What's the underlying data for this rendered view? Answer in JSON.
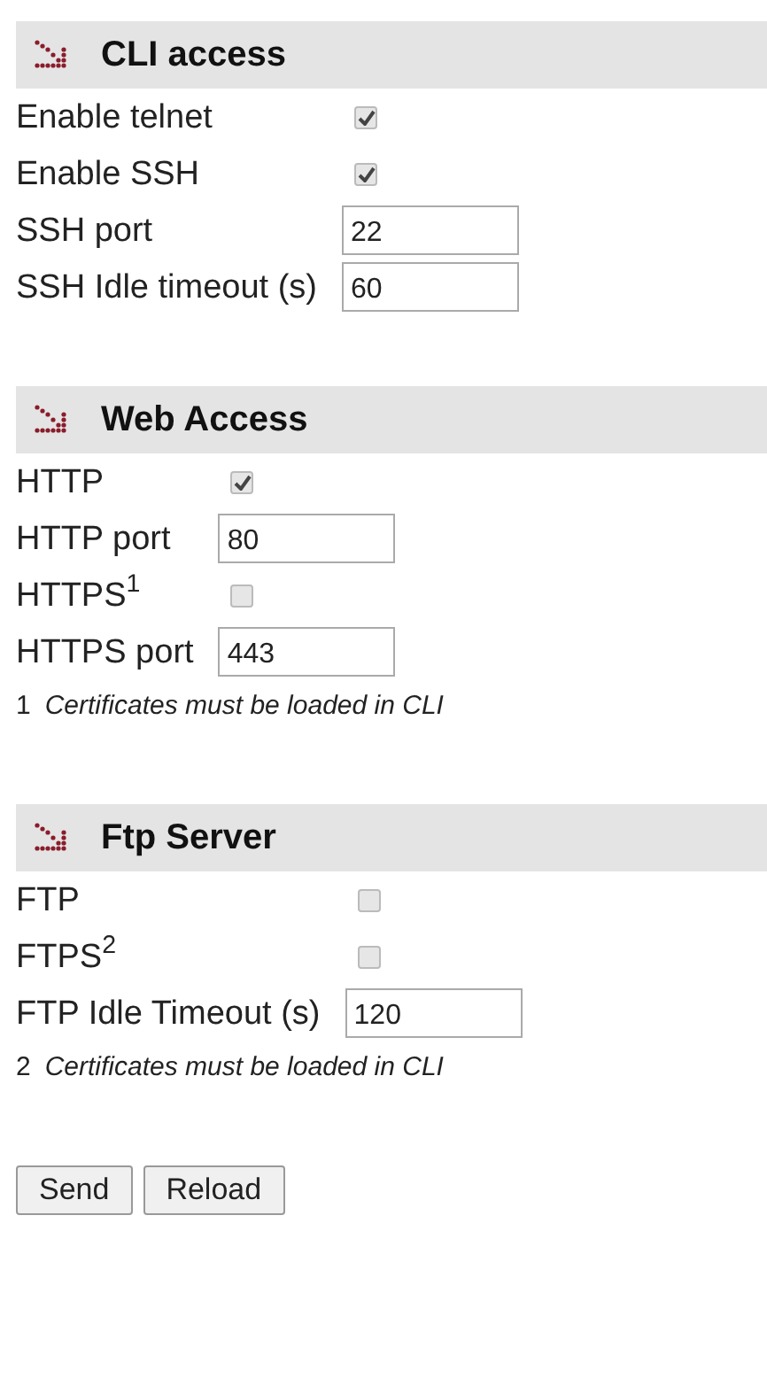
{
  "sections": [
    {
      "title": "CLI access",
      "rows": [
        {
          "kind": "checkbox",
          "label": "Enable telnet",
          "checked": true
        },
        {
          "kind": "checkbox",
          "label": "Enable SSH",
          "checked": true
        },
        {
          "kind": "field",
          "label": "SSH port",
          "value": "22"
        },
        {
          "kind": "field",
          "label": "SSH Idle timeout (s)",
          "value": "60"
        }
      ]
    },
    {
      "title": "Web Access",
      "rows": [
        {
          "kind": "checkbox",
          "label": "HTTP",
          "checked": true
        },
        {
          "kind": "field",
          "label": "HTTP port",
          "value": "80"
        },
        {
          "kind": "checkbox",
          "label": "HTTPS$^{1}$",
          "checked": false
        },
        {
          "kind": "field",
          "label": "HTTPS port",
          "value": "443"
        }
      ],
      "footnote": {
        "mark": "1",
        "text": "Certificates must be loaded in CLI"
      }
    },
    {
      "title": "Ftp Server",
      "rows": [
        {
          "kind": "checkbox",
          "label": "FTP",
          "checked": false
        },
        {
          "kind": "checkbox",
          "label": "FTPS$^{2}$",
          "checked": false
        },
        {
          "kind": "field",
          "label": "FTP Idle Timeout (s)",
          "value": "120"
        }
      ],
      "footnote": {
        "mark": "2",
        "text": "Certificates must be loaded in CLI"
      }
    }
  ],
  "buttons": [
    "Send",
    "Reload"
  ]
}
